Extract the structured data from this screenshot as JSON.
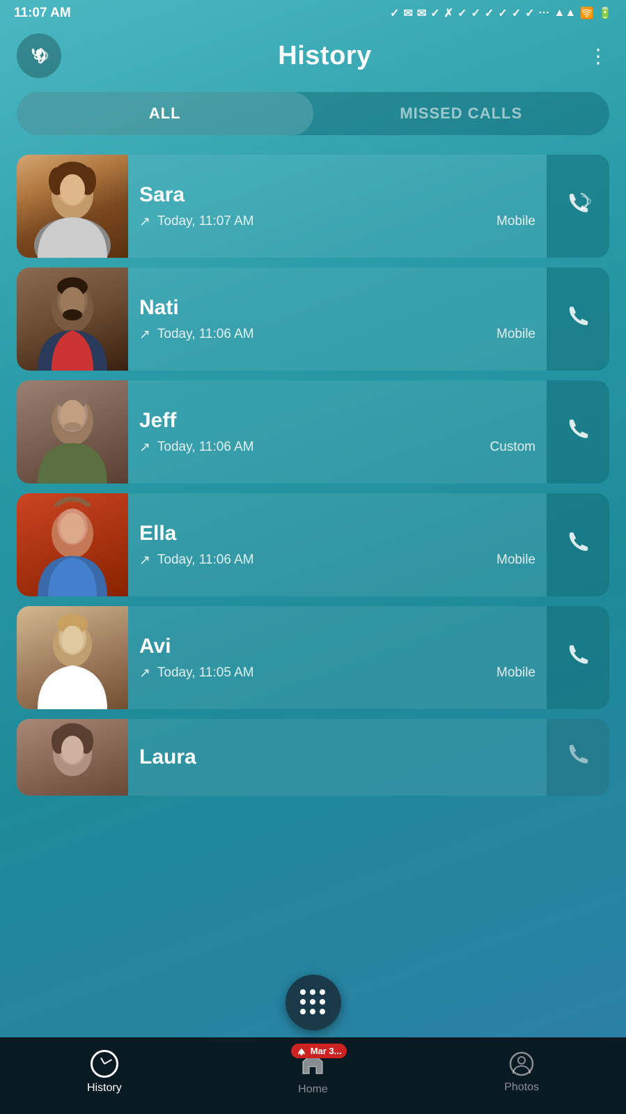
{
  "statusBar": {
    "time": "11:07 AM",
    "icons": "✓ ✉ ✉ ✓ ✗ ✓ ✓ ✓ ✓ ✓ ✓ ✓ ··· ▲ ☁ 🔋"
  },
  "header": {
    "title": "History",
    "moreButton": "⋮"
  },
  "filterTabs": {
    "all": "ALL",
    "missedCalls": "MISSED CALLS",
    "activeTab": "all"
  },
  "calls": [
    {
      "id": "sara",
      "name": "Sara",
      "time": "Today, 11:07 AM",
      "type": "Mobile",
      "faceClass": "face-sara",
      "faceEmoji": "👩"
    },
    {
      "id": "nati",
      "name": "Nati",
      "time": "Today, 11:06 AM",
      "type": "Mobile",
      "faceClass": "face-nati",
      "faceEmoji": "👨"
    },
    {
      "id": "jeff",
      "name": "Jeff",
      "time": "Today, 11:06 AM",
      "type": "Custom",
      "faceClass": "face-jeff",
      "faceEmoji": "👨"
    },
    {
      "id": "ella",
      "name": "Ella",
      "time": "Today, 11:06 AM",
      "type": "Mobile",
      "faceClass": "face-ella",
      "faceEmoji": "👩"
    },
    {
      "id": "avi",
      "name": "Avi",
      "time": "Today, 11:05 AM",
      "type": "Mobile",
      "faceClass": "face-avi",
      "faceEmoji": "👨"
    },
    {
      "id": "laura",
      "name": "Laura",
      "time": "",
      "type": "",
      "faceClass": "face-laura",
      "faceEmoji": "👩"
    }
  ],
  "bottomNav": {
    "history": "History",
    "home": "Home",
    "photos": "Photos",
    "missedBadge": "Mar 3..."
  }
}
